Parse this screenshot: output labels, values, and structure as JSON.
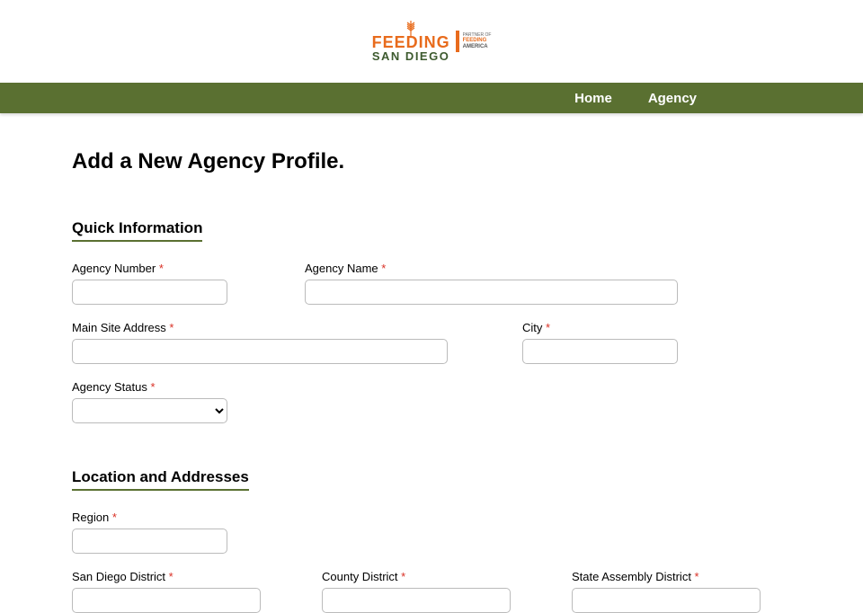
{
  "logo": {
    "feeding": "FEEDING",
    "sandiego": "SAN DIEGO",
    "partner_top": "PARTNER OF",
    "partner_feeding": "FEEDING",
    "partner_america": "AMERICA"
  },
  "nav": {
    "home": "Home",
    "agency": "Agency"
  },
  "page_title": "Add a New Agency Profile.",
  "sections": {
    "quick_info": "Quick Information",
    "location": "Location and Addresses"
  },
  "fields": {
    "agency_number": {
      "label": "Agency Number",
      "required": true,
      "value": ""
    },
    "agency_name": {
      "label": "Agency Name",
      "required": true,
      "value": ""
    },
    "main_site_address": {
      "label": "Main Site Address",
      "required": true,
      "value": ""
    },
    "city": {
      "label": "City",
      "required": true,
      "value": ""
    },
    "agency_status": {
      "label": "Agency Status",
      "required": true,
      "value": ""
    },
    "region": {
      "label": "Region",
      "required": true,
      "value": ""
    },
    "san_diego_district": {
      "label": "San Diego District",
      "required": true,
      "value": ""
    },
    "county_district": {
      "label": "County District",
      "required": true,
      "value": ""
    },
    "state_assembly_district": {
      "label": "State Assembly District",
      "required": true,
      "value": ""
    }
  },
  "required_marker": " *"
}
